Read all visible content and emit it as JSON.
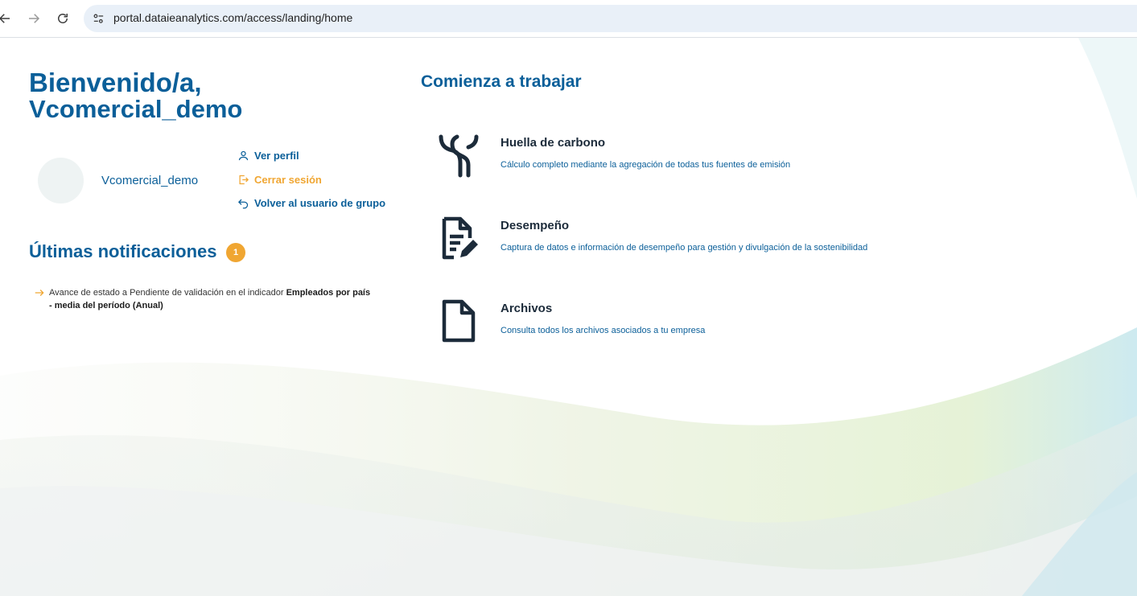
{
  "browser": {
    "url": "portal.dataieanalytics.com/access/landing/home"
  },
  "welcome": {
    "greeting": "Bienvenido/a,",
    "username": "Vcomercial_demo"
  },
  "profile": {
    "name": "Vcomercial_demo",
    "links": [
      {
        "label": "Ver perfil"
      },
      {
        "label": "Cerrar sesión"
      },
      {
        "label": "Volver al usuario de grupo"
      }
    ]
  },
  "notifications": {
    "title": "Últimas notificaciones",
    "count": "1",
    "items": [
      {
        "text": "Avance de estado a Pendiente de validación en el indicador ",
        "bold": "Empleados por país - media del período (Anual)"
      }
    ]
  },
  "start": {
    "title": "Comienza a trabajar",
    "modules": [
      {
        "title": "Huella de carbono",
        "description": "Cálculo completo mediante la agregación de todas tus fuentes de emisión",
        "icon": "carbon-footprint-icon"
      },
      {
        "title": "Desempeño",
        "description": "Captura de datos e información de desempeño para gestión y divulgación de la sostenibilidad",
        "icon": "document-edit-icon"
      },
      {
        "title": "Archivos",
        "description": "Consulta todos los archivos asociados a tu empresa",
        "icon": "file-icon"
      }
    ]
  },
  "colors": {
    "primary": "#0b5f99",
    "accent": "#f0a632",
    "icon_dark": "#1c2b3a"
  }
}
